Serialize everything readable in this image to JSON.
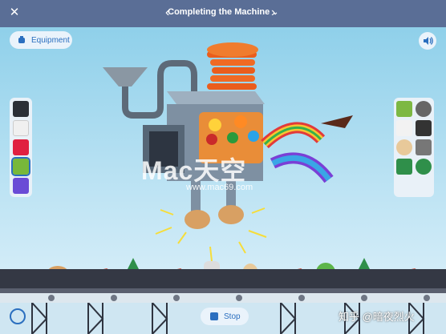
{
  "header": {
    "title": "Completing the Machine",
    "close_icon": "close-icon",
    "prev_icon": "chevron-left-icon",
    "next_icon": "chevron-right-icon",
    "menu_icon": "chevron-down-icon"
  },
  "equipment": {
    "label": "Equipment",
    "icon": "robot-icon"
  },
  "sound": {
    "icon": "speaker-icon"
  },
  "left_palette": {
    "items": [
      {
        "name": "black-cube",
        "color": "#2b2f36"
      },
      {
        "name": "white-cube",
        "color": "#f0f0f0"
      },
      {
        "name": "red-cube",
        "color": "#e02040"
      },
      {
        "name": "green-layer-cube",
        "color": "#78b83a"
      },
      {
        "name": "purple-cube",
        "color": "#6a4bd6"
      }
    ]
  },
  "right_palette": {
    "items": [
      {
        "name": "gear-icon",
        "color": "#555"
      },
      {
        "name": "rock-icon",
        "color": "#333"
      },
      {
        "name": "spring-icon",
        "color": "#333"
      },
      {
        "name": "egg-icon",
        "color": "#e8c99a"
      },
      {
        "name": "tree-icon",
        "color": "#2f8f4a"
      },
      {
        "name": "stack-icon",
        "color": "#7db843"
      },
      {
        "name": "chip-icon",
        "color": "#777"
      },
      {
        "name": "dragon-icon",
        "color": "#2f8f4a"
      }
    ]
  },
  "controls": {
    "stop_label": "Stop",
    "timer_icon": "timer-icon"
  },
  "watermark": {
    "brand": "Mac天空",
    "url": "www.mac69.com",
    "site": "知乎 @暗夜烈火"
  },
  "colors": {
    "accent": "#2b6fbf",
    "topbar": "#5a6e96",
    "belt": "#343844"
  }
}
